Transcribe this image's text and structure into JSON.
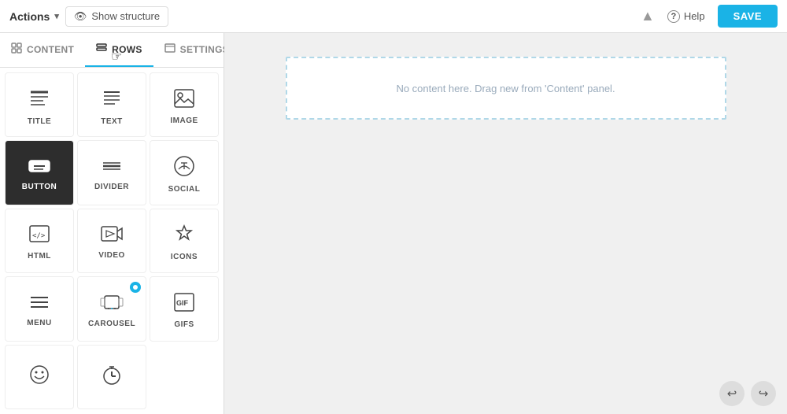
{
  "topbar": {
    "actions_label": "Actions",
    "structure_label": "Show structure",
    "help_label": "Help",
    "save_label": "SAVE"
  },
  "tabs": [
    {
      "id": "content",
      "label": "CONTENT",
      "icon": "grid"
    },
    {
      "id": "rows",
      "label": "ROWS",
      "icon": "rows",
      "active": true
    },
    {
      "id": "settings",
      "label": "SETTINGS",
      "icon": "settings"
    }
  ],
  "items": [
    {
      "id": "title",
      "label": "TITLE",
      "icon": "title",
      "active": false
    },
    {
      "id": "text",
      "label": "TEXT",
      "icon": "text",
      "active": false
    },
    {
      "id": "image",
      "label": "IMAGE",
      "icon": "image",
      "active": false
    },
    {
      "id": "button",
      "label": "BUTTON",
      "icon": "button",
      "active": true
    },
    {
      "id": "divider",
      "label": "DIVIDER",
      "icon": "divider",
      "active": false
    },
    {
      "id": "social",
      "label": "SOCIAL",
      "icon": "social",
      "active": false
    },
    {
      "id": "html",
      "label": "HTML",
      "icon": "html",
      "active": false
    },
    {
      "id": "video",
      "label": "VIDEO",
      "icon": "video",
      "active": false
    },
    {
      "id": "icons",
      "label": "ICONS",
      "icon": "icons",
      "active": false
    },
    {
      "id": "menu",
      "label": "MENU",
      "icon": "menu",
      "active": false
    },
    {
      "id": "carousel",
      "label": "CAROUSEL",
      "icon": "carousel",
      "badge": true,
      "active": false
    },
    {
      "id": "gifs",
      "label": "GIFS",
      "icon": "gifs",
      "active": false
    },
    {
      "id": "sticker",
      "label": "",
      "icon": "sticker",
      "active": false
    },
    {
      "id": "timer",
      "label": "",
      "icon": "timer",
      "active": false
    }
  ],
  "canvas": {
    "placeholder": "No content here. Drag new from 'Content' panel."
  }
}
